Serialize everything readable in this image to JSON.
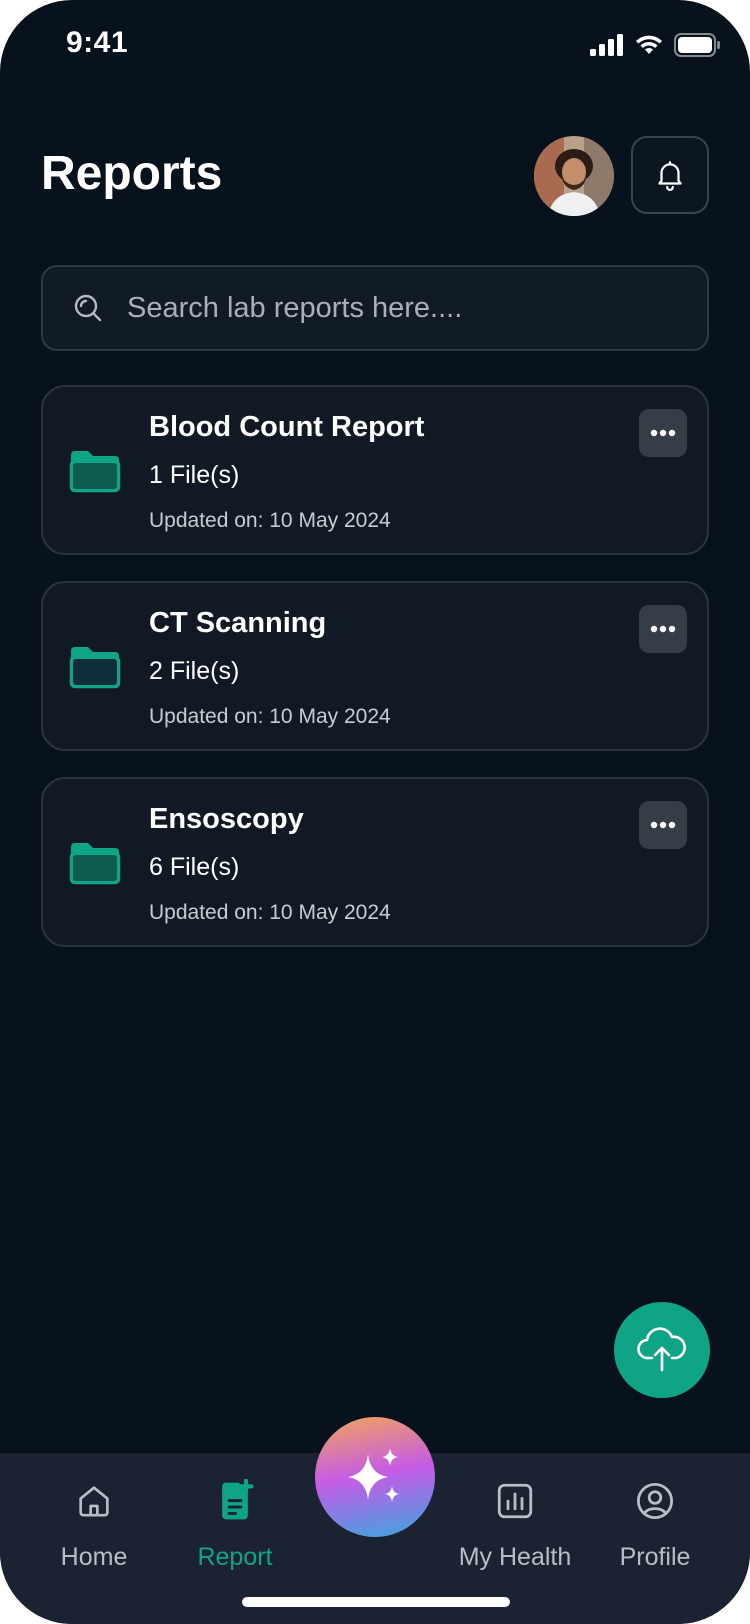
{
  "status_bar": {
    "time": "9:41"
  },
  "header": {
    "title": "Reports"
  },
  "search": {
    "placeholder": "Search lab reports here...."
  },
  "reports": [
    {
      "title": "Blood Count Report",
      "files": "1 File(s)",
      "updated": "Updated on: 10 May 2024"
    },
    {
      "title": "CT Scanning",
      "files": "2 File(s)",
      "updated": "Updated on: 10 May 2024"
    },
    {
      "title": "Ensoscopy",
      "files": "6 File(s)",
      "updated": "Updated on: 10 May 2024"
    }
  ],
  "nav": {
    "home": "Home",
    "report": "Report",
    "my_health": "My Health",
    "profile": "Profile",
    "active": "report"
  },
  "colors": {
    "background": "#08121c",
    "accent": "#10a487",
    "card": "#111a24",
    "nav": "#1b2231"
  },
  "icons": [
    "search-icon",
    "bell-icon",
    "folder-icon",
    "more-icon",
    "upload-cloud-icon",
    "home-icon",
    "report-icon",
    "sparkle-icon",
    "health-chart-icon",
    "profile-icon"
  ]
}
